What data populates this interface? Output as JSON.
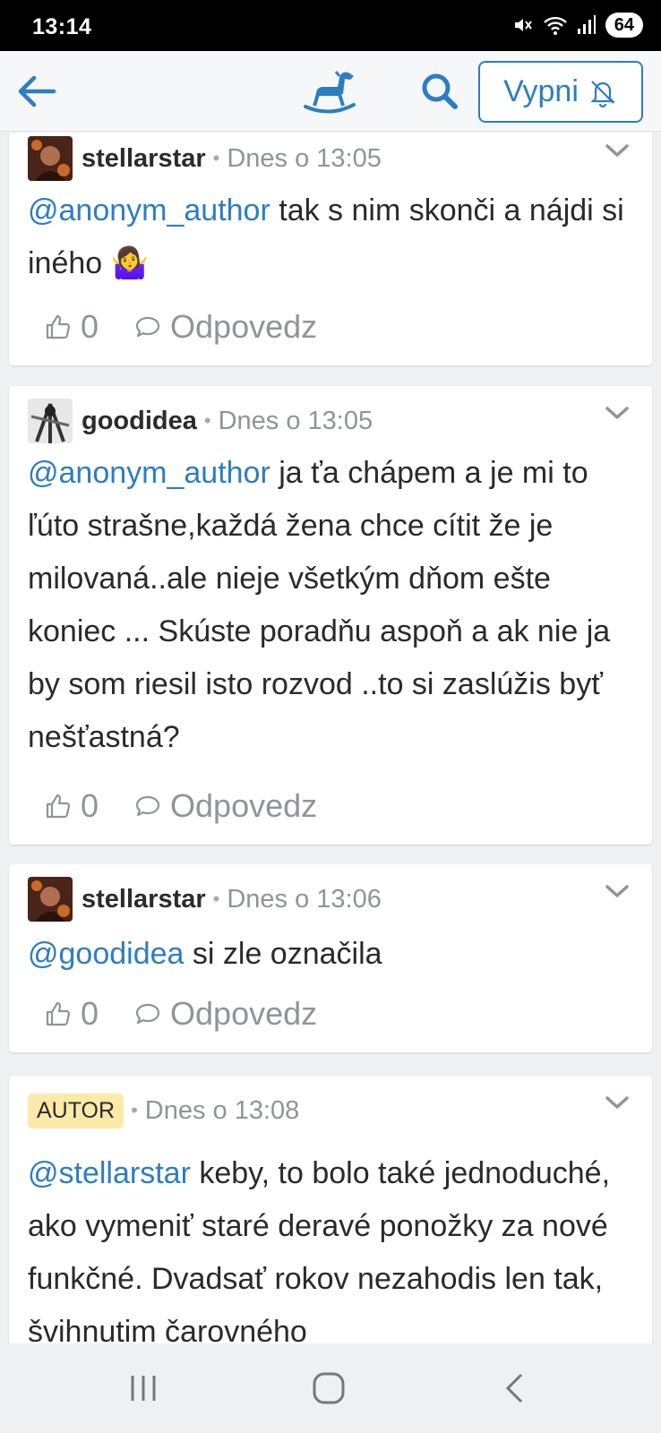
{
  "status": {
    "time": "13:14",
    "battery": "64"
  },
  "appbar": {
    "mute_label": "Vypni"
  },
  "comments": [
    {
      "user": "stellarstar",
      "date": "Dnes o 13:05",
      "mention": "@anonym_author",
      "text": " tak s nim skonči a nájdi si iného 🤷‍♀️",
      "likes": "0",
      "reply_label": "Odpovedz"
    },
    {
      "user": "goodidea",
      "date": "Dnes o 13:05",
      "mention": "@anonym_author",
      "text": " ja ťa chápem a je mi to ľúto strašne,každá žena chce cítit že je milovaná..ale nieje všetkým dňom ešte koniec ... Skúste poradňu aspoň a ak nie ja by som riesil isto rozvod ..to si zaslúžis byť nešťastná?",
      "likes": "0",
      "reply_label": "Odpovedz"
    },
    {
      "user": "stellarstar",
      "date": "Dnes o 13:06",
      "mention": "@goodidea",
      "text": " si zle označila",
      "likes": "0",
      "reply_label": "Odpovedz"
    },
    {
      "badge": "AUTOR",
      "date": "Dnes o 13:08",
      "mention": "@stellarstar",
      "text": " keby, to bolo také jednoduché, ako vymeniť staré deravé ponožky za nové funkčné. Dvadsať rokov nezahodis len tak, švihnutim čarovného"
    }
  ],
  "colors": {
    "accent": "#2e7dc1",
    "badge": "#fde9a9",
    "muted": "#8e949a"
  }
}
